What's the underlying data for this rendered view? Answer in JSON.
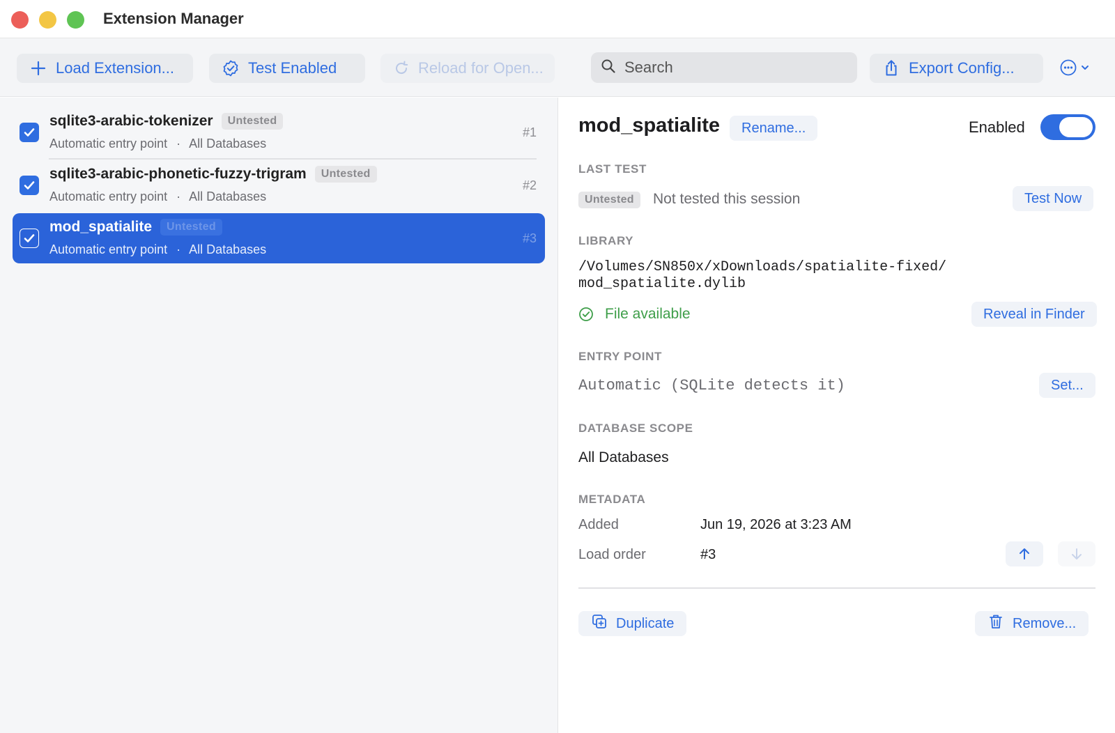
{
  "window": {
    "title": "Extension Manager"
  },
  "toolbar": {
    "load_label": "Load Extension...",
    "test_label": "Test Enabled",
    "reload_label": "Reload for Open...",
    "search_placeholder": "Search",
    "export_label": "Export Config..."
  },
  "sidebar": {
    "items": [
      {
        "name": "sqlite3-arabic-tokenizer",
        "badge": "Untested",
        "entry": "Automatic entry point",
        "separator": "·",
        "scope": "All Databases",
        "order": "#1",
        "checked": true,
        "selected": false
      },
      {
        "name": "sqlite3-arabic-phonetic-fuzzy-trigram",
        "badge": "Untested",
        "entry": "Automatic entry point",
        "separator": "·",
        "scope": "All Databases",
        "order": "#2",
        "checked": true,
        "selected": false
      },
      {
        "name": "mod_spatialite",
        "badge": "Untested",
        "entry": "Automatic entry point",
        "separator": "·",
        "scope": "All Databases",
        "order": "#3",
        "checked": true,
        "selected": true
      }
    ]
  },
  "detail": {
    "title": "mod_spatialite",
    "rename_label": "Rename...",
    "enabled_label": "Enabled",
    "enabled": true,
    "last_test": {
      "section": "LAST TEST",
      "badge": "Untested",
      "status": "Not tested this session",
      "test_now_label": "Test Now"
    },
    "library": {
      "section": "LIBRARY",
      "path_line1": "/Volumes/SN850x/xDownloads/spatialite-fixed/",
      "path_line2": "mod_spatialite.dylib",
      "file_status": "File available",
      "reveal_label": "Reveal in Finder"
    },
    "entry_point": {
      "section": "ENTRY POINT",
      "value": "Automatic (SQLite detects it)",
      "set_label": "Set..."
    },
    "database_scope": {
      "section": "DATABASE SCOPE",
      "value": "All Databases"
    },
    "metadata": {
      "section": "METADATA",
      "added_label": "Added",
      "added_value": "Jun 19, 2026 at 3:23 AM",
      "load_order_label": "Load order",
      "load_order_value": "#3"
    },
    "duplicate_label": "Duplicate",
    "remove_label": "Remove..."
  },
  "colors": {
    "accent": "#2f6de0",
    "selection": "#2b63d9",
    "success": "#3e9e49",
    "close": "#ec5f59",
    "minimize": "#f3c644",
    "maximize": "#5fc454"
  }
}
